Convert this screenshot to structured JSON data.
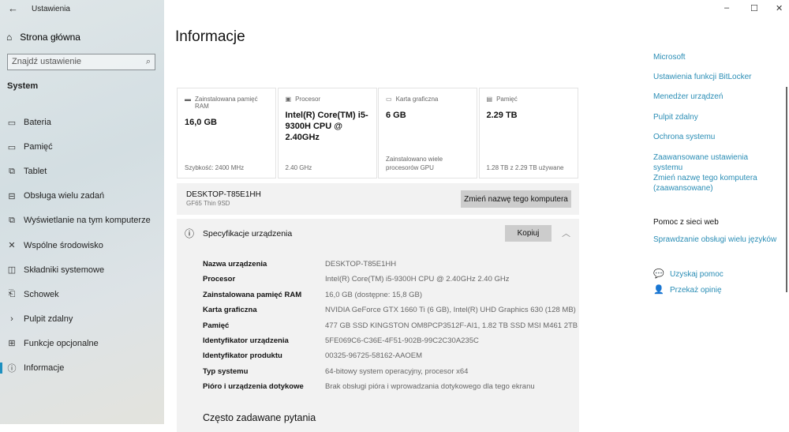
{
  "app": {
    "title": "Ustawienia",
    "back_icon": "arrow-left-icon"
  },
  "window": {
    "minimize": "–",
    "maximize": "☐",
    "close": "✕"
  },
  "sidebar": {
    "home": "Strona główna",
    "search_placeholder": "Znajdź ustawienie",
    "section": "System",
    "items": [
      {
        "label": "Bateria",
        "icon": "▭"
      },
      {
        "label": "Pamięć",
        "icon": "▭"
      },
      {
        "label": "Tablet",
        "icon": "⧉"
      },
      {
        "label": "Obsługa wielu zadań",
        "icon": "⊟"
      },
      {
        "label": "Wyświetlanie na tym komputerze",
        "icon": "⧉"
      },
      {
        "label": "Wspólne środowisko",
        "icon": "✕"
      },
      {
        "label": "Składniki systemowe",
        "icon": "◫"
      },
      {
        "label": "Schowek",
        "icon": "⎗"
      },
      {
        "label": "Pulpit zdalny",
        "icon": "›"
      },
      {
        "label": "Funkcje opcjonalne",
        "icon": "⊞"
      },
      {
        "label": "Informacje",
        "icon": "ⓘ"
      }
    ]
  },
  "main": {
    "title": "Informacje",
    "cards": [
      {
        "label": "Zainstalowana pamięć RAM",
        "value": "16,0 GB",
        "sub": "Szybkość: 2400 MHz"
      },
      {
        "label": "Procesor",
        "value": "Intel(R) Core(TM) i5-9300H CPU @ 2.40GHz",
        "sub": "2.40 GHz"
      },
      {
        "label": "Karta graficzna",
        "value": "6 GB",
        "sub": "Zainstalowano wiele procesorów GPU"
      },
      {
        "label": "Pamięć",
        "value": "2.29 TB",
        "sub": "1.28 TB z 2.29 TB używane"
      }
    ],
    "device_name": "DESKTOP-T85E1HH",
    "model": "GF65 Thin 9SD",
    "rename_button": "Zmień nazwę tego komputera",
    "spec_title": "Specyfikacje urządzenia",
    "copy_button": "Kopiuj",
    "specs": [
      {
        "k": "Nazwa urządzenia",
        "v": "DESKTOP-T85E1HH"
      },
      {
        "k": "Procesor",
        "v": "Intel(R) Core(TM) i5-9300H CPU @ 2.40GHz   2.40 GHz"
      },
      {
        "k": "Zainstalowana pamięć RAM",
        "v": "16,0 GB (dostępne: 15,8 GB)"
      },
      {
        "k": "Karta graficzna",
        "v": "NVIDIA GeForce GTX 1660 Ti (6 GB), Intel(R) UHD Graphics 630 (128 MB)"
      },
      {
        "k": "Pamięć",
        "v": "477 GB SSD KINGSTON OM8PCP3512F-AI1, 1.82 TB SSD MSI M461 2TB"
      },
      {
        "k": "Identyfikator urządzenia",
        "v": "5FE069C6-C36E-4F51-902B-99C2C30A235C"
      },
      {
        "k": "Identyfikator produktu",
        "v": "00325-96725-58162-AAOEM"
      },
      {
        "k": "Typ systemu",
        "v": "64-bitowy system operacyjny, procesor x64"
      },
      {
        "k": "Pióro i urządzenia dotykowe",
        "v": "Brak obsługi pióra i wprowadzania dotykowego dla tego ekranu"
      }
    ],
    "faq": "Często zadawane pytania"
  },
  "right": {
    "links": [
      "Microsoft",
      "Ustawienia funkcji BitLocker",
      "Menedżer urządzeń",
      "Pulpit zdalny",
      "Ochrona systemu",
      "Zaawansowane ustawienia systemu",
      "Zmień nazwę tego komputera (zaawansowane)"
    ],
    "web_help": "Pomoc z sieci web",
    "web_link": "Sprawdzanie obsługi wielu języków",
    "get_help": "Uzyskaj pomoc",
    "feedback": "Przekaż opinię"
  }
}
